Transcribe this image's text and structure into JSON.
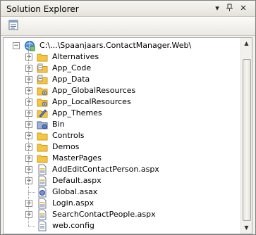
{
  "title": "Solution Explorer",
  "project": {
    "label": "C:\\...\\Spaanjaars.ContactManager.Web\\",
    "expander": "−"
  },
  "items": [
    {
      "label": "Alternatives",
      "icon": "folder-icon",
      "expander": "+"
    },
    {
      "label": "App_Code",
      "icon": "special-folder-icon",
      "expander": "+"
    },
    {
      "label": "App_Data",
      "icon": "special-folder-icon",
      "expander": "+"
    },
    {
      "label": "App_GlobalResources",
      "icon": "resources-folder-icon",
      "expander": "+"
    },
    {
      "label": "App_LocalResources",
      "icon": "resources-folder-icon",
      "expander": "+"
    },
    {
      "label": "App_Themes",
      "icon": "themes-folder-icon",
      "expander": "+"
    },
    {
      "label": "Bin",
      "icon": "bin-folder-icon",
      "expander": "+"
    },
    {
      "label": "Controls",
      "icon": "folder-icon",
      "expander": "+"
    },
    {
      "label": "Demos",
      "icon": "folder-icon",
      "expander": "+"
    },
    {
      "label": "MasterPages",
      "icon": "folder-icon",
      "expander": "+"
    },
    {
      "label": "AddEditContactPerson.aspx",
      "icon": "aspx-file-icon",
      "expander": "+"
    },
    {
      "label": "Default.aspx",
      "icon": "aspx-file-icon",
      "expander": "+"
    },
    {
      "label": "Global.asax",
      "icon": "asax-file-icon",
      "expander": ""
    },
    {
      "label": "Login.aspx",
      "icon": "aspx-file-icon",
      "expander": "+"
    },
    {
      "label": "SearchContactPeople.aspx",
      "icon": "aspx-file-icon",
      "expander": "+"
    },
    {
      "label": "web.config",
      "icon": "config-file-icon",
      "expander": ""
    }
  ],
  "colors": {
    "folder": "#f5c542",
    "folder_edge": "#c99a1c"
  }
}
